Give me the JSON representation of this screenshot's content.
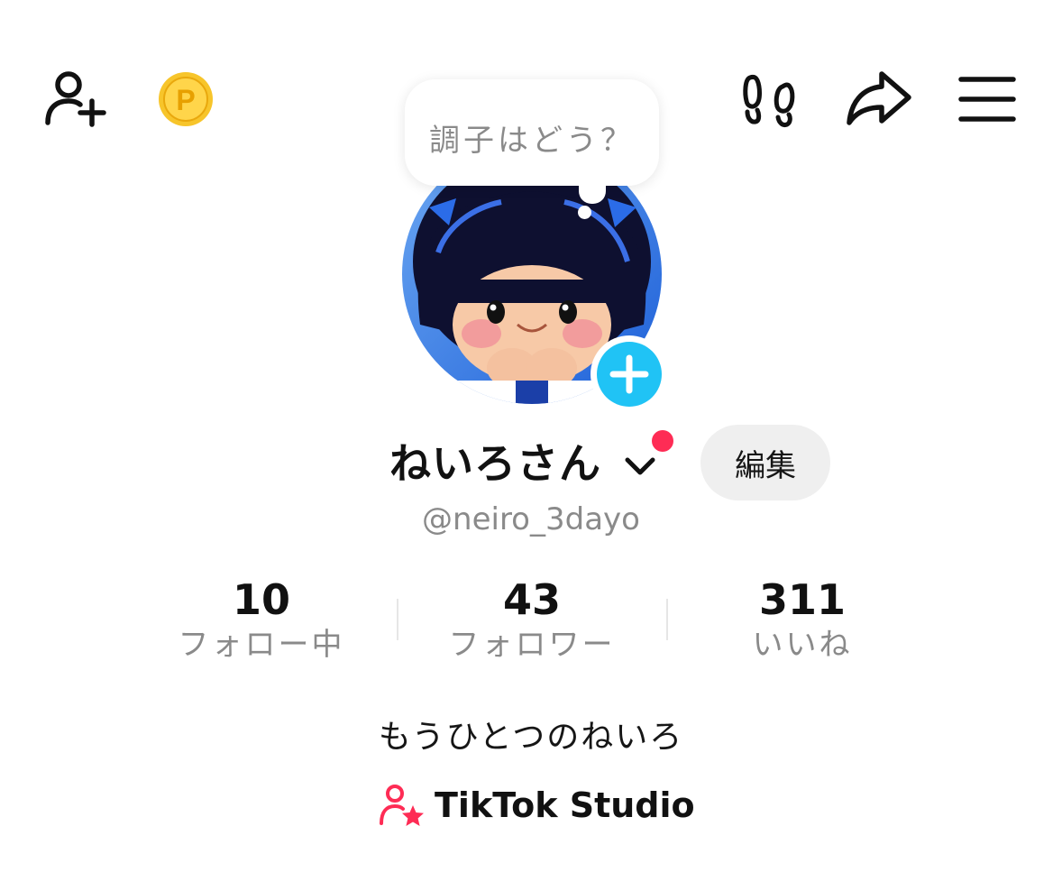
{
  "header": {
    "icons": {
      "add_friend": "add-user-icon",
      "coins": "coin-icon",
      "profile_views": "footprint-icon",
      "share": "share-icon",
      "menu": "menu-icon"
    },
    "coin_letter": "P"
  },
  "status_bubble": {
    "text": "調子はどう？"
  },
  "profile": {
    "display_name": "ねいろさん",
    "username": "@neiro_3dayo",
    "edit_label": "編集",
    "bio": "もうひとつのねいろ"
  },
  "stats": [
    {
      "value": "10",
      "label": "フォロー中"
    },
    {
      "value": "43",
      "label": "フォロワー"
    },
    {
      "value": "311",
      "label": "いいね"
    }
  ],
  "studio": {
    "label": "TikTok Studio"
  },
  "colors": {
    "accent": "#fe2c55",
    "add_button": "#20c3f5",
    "coin": "#f5b81d",
    "secondary_text": "#8a8a8a",
    "button_bg": "#efefef"
  }
}
